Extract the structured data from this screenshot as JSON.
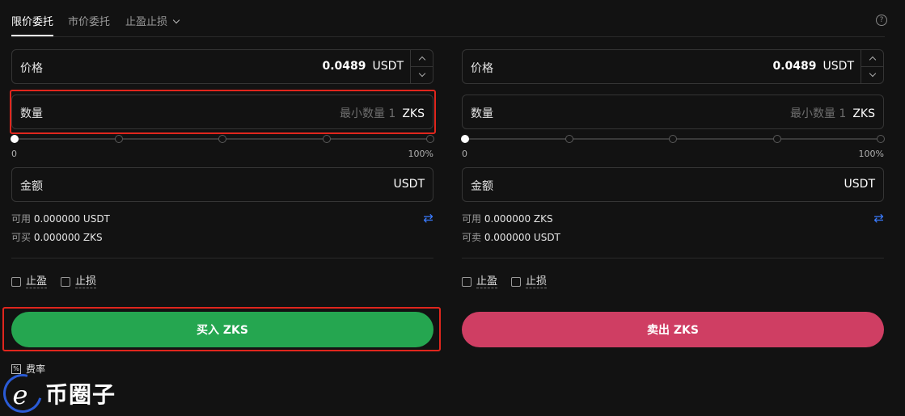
{
  "tabs": [
    {
      "label": "限价委托",
      "active": true
    },
    {
      "label": "市价委托",
      "active": false
    },
    {
      "label": "止盈止损",
      "active": false
    }
  ],
  "help_icon": "question-circle-icon",
  "buy": {
    "price": {
      "label": "价格",
      "value": "0.0489",
      "unit": "USDT"
    },
    "amount": {
      "label": "数量",
      "placeholder": "最小数量 1",
      "unit": "ZKS"
    },
    "slider": {
      "min_label": "0",
      "max_label": "100%",
      "value_percent": 0
    },
    "total": {
      "label": "金额",
      "unit": "USDT"
    },
    "available_label": "可用",
    "available_value": "0.000000 USDT",
    "max_label": "可买",
    "max_value": "0.000000 ZKS",
    "take_profit": "止盈",
    "stop_loss": "止损",
    "button_label": "买入 ZKS",
    "button_color": "#25a650"
  },
  "sell": {
    "price": {
      "label": "价格",
      "value": "0.0489",
      "unit": "USDT"
    },
    "amount": {
      "label": "数量",
      "placeholder": "最小数量 1",
      "unit": "ZKS"
    },
    "slider": {
      "min_label": "0",
      "max_label": "100%",
      "value_percent": 0
    },
    "total": {
      "label": "金额",
      "unit": "USDT"
    },
    "available_label": "可用",
    "available_value": "0.000000 ZKS",
    "max_label": "可卖",
    "max_value": "0.000000 USDT",
    "take_profit": "止盈",
    "stop_loss": "止损",
    "button_label": "卖出 ZKS",
    "button_color": "#cf3e63"
  },
  "fee_label": "费率",
  "watermark": "币圈子",
  "highlight_color": "#e0261d"
}
